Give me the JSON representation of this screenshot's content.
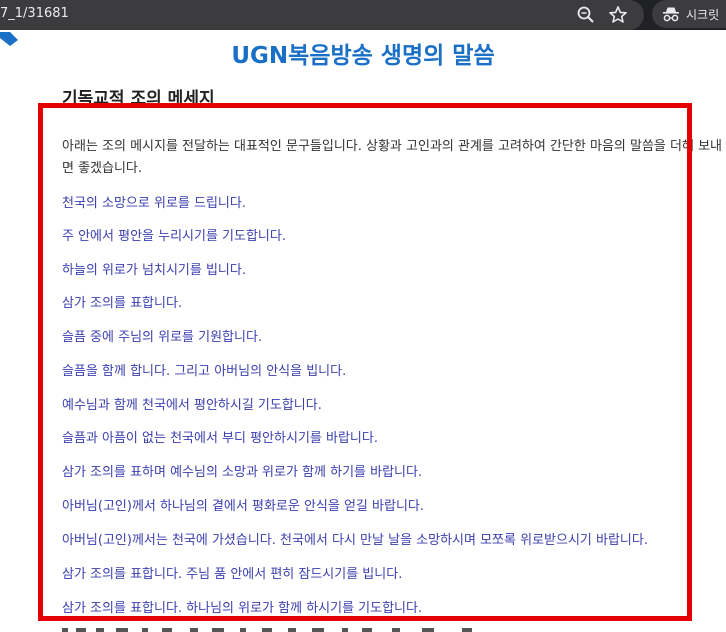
{
  "browser": {
    "url_fragment": "7_1/31681",
    "incognito_label": "시크릿"
  },
  "page": {
    "title": "UGN복음방송 생명의 말씀",
    "section_heading": "기독교적 조의 메세지",
    "intro": "아래는 조의 메시지를 전달하는 대표적인 문구들입니다. 상황과 고인과의 관계를 고려하여 간단한 마음의 말씀을 더해 보내면 좋겠습니다.",
    "messages": [
      "천국의 소망으로 위로를 드립니다.",
      "주 안에서 평안을 누리시기를 기도합니다.",
      "하늘의 위로가 넘치시기를 빕니다.",
      "삼가 조의를 표합니다.",
      "슬픔 중에 주님의 위로를 기원합니다.",
      "슬픔을 함께 합니다. 그리고 아버님의 안식을 빕니다.",
      "예수님과 함께 천국에서 평안하시길 기도합니다.",
      "슬픔과 아픔이 없는 천국에서 부디 평안하시기를 바랍니다.",
      "삼가 조의를 표하며 예수님의 소망과 위로가 함께 하기를 바랍니다.",
      "아버님(고인)께서 하나님의 곁에서 평화로운 안식을 얻길 바랍니다.",
      "아버님(고인)께서는 천국에 가셨습니다. 천국에서 다시 만날 날을 소망하시며 모쪼록 위로받으시기 바랍니다.",
      "삼가 조의를 표합니다. 주님 품 안에서 편히 잠드시기를 빕니다.",
      "삼가 조의를 표합니다. 하나님의 위로가 함께 하시기를 기도합니다."
    ]
  },
  "colors": {
    "title": "#1a6fc6",
    "message_text": "#3b3fae",
    "highlight_border": "#e50000"
  }
}
